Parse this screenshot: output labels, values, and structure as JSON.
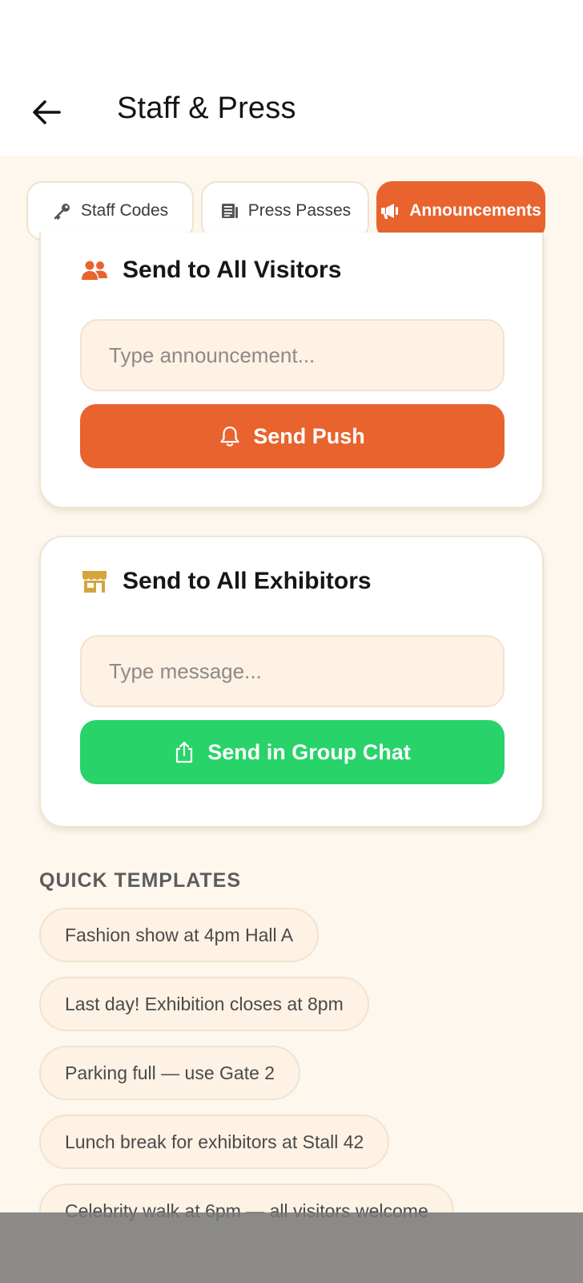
{
  "header": {
    "title": "Staff & Press",
    "back_icon": "arrow-left-icon"
  },
  "tabs": [
    {
      "label": "Staff Codes",
      "icon": "key-icon",
      "active": false
    },
    {
      "label": "Press Passes",
      "icon": "newspaper-icon",
      "active": false
    },
    {
      "label": "Announcements",
      "icon": "megaphone-icon",
      "active": true
    }
  ],
  "visitors_card": {
    "title": "Send to All Visitors",
    "icon": "users-icon",
    "input_placeholder": "Type announcement...",
    "button_label": "Send Push",
    "button_icon": "bell-icon"
  },
  "exhibitors_card": {
    "title": "Send to All Exhibitors",
    "icon": "store-icon",
    "input_placeholder": "Type message...",
    "button_label": "Send in Group Chat",
    "button_icon": "share-icon"
  },
  "templates": {
    "label": "QUICK TEMPLATES",
    "items": [
      "Fashion show at 4pm Hall A",
      "Last day! Exhibition closes at 8pm",
      "Parking full — use Gate 2",
      "Lunch break for exhibitors at Stall 42",
      "Celebrity walk at 6pm — all visitors welcome"
    ]
  },
  "colors": {
    "accent": "#e8632e",
    "green": "#28d36a",
    "background": "#fdf7ee"
  }
}
